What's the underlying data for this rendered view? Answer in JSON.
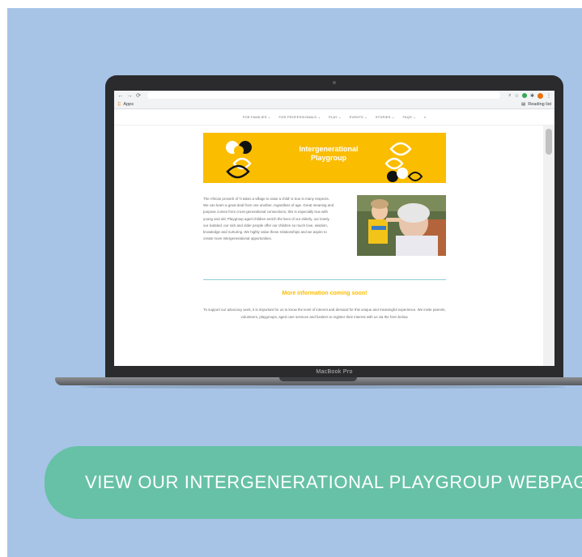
{
  "browser": {
    "bookmark_apps": "Apps",
    "reading_list": "Reading list"
  },
  "site_nav": [
    "FOR FAMILIES ⌄",
    "FOR PROFESSIONALS ⌄",
    "PLAY ⌄",
    "EVENTS ⌄",
    "STORIES ⌄",
    "FAQS ⌄"
  ],
  "banner": {
    "title": "Intergenerational Playgroup",
    "color": "#fbbd00"
  },
  "intro_text": "The African proverb of 'It takes a village to raise a child' is true in many respects. We can learn a great deal from one another, regardless of age. Great meaning and purpose comes from cross-generational connections, this is especially true with young and old. Playgroup aged children enrich the lives of our elderly, our lonely, our isolated, our sick and older people offer our children so much love, wisdom, knowledge and nurturing. We highly value these relationships and we aspire to create more intergenerational opportunities.",
  "more_heading": "More information coming soon!",
  "support_text": "To support our advocacy work, it is important for us to know the level of interest and demand for this unique and meaningful experience. We invite parents, volunteers, playgroups, aged care services and funders to register their interest with us via the form below.",
  "device_label": "MacBook Pro",
  "cta": {
    "label": "VIEW OUR INTERGENERATIONAL PLAYGROUP WEBPAG",
    "color": "#67c1a6"
  },
  "background_color": "#a7c4e7"
}
